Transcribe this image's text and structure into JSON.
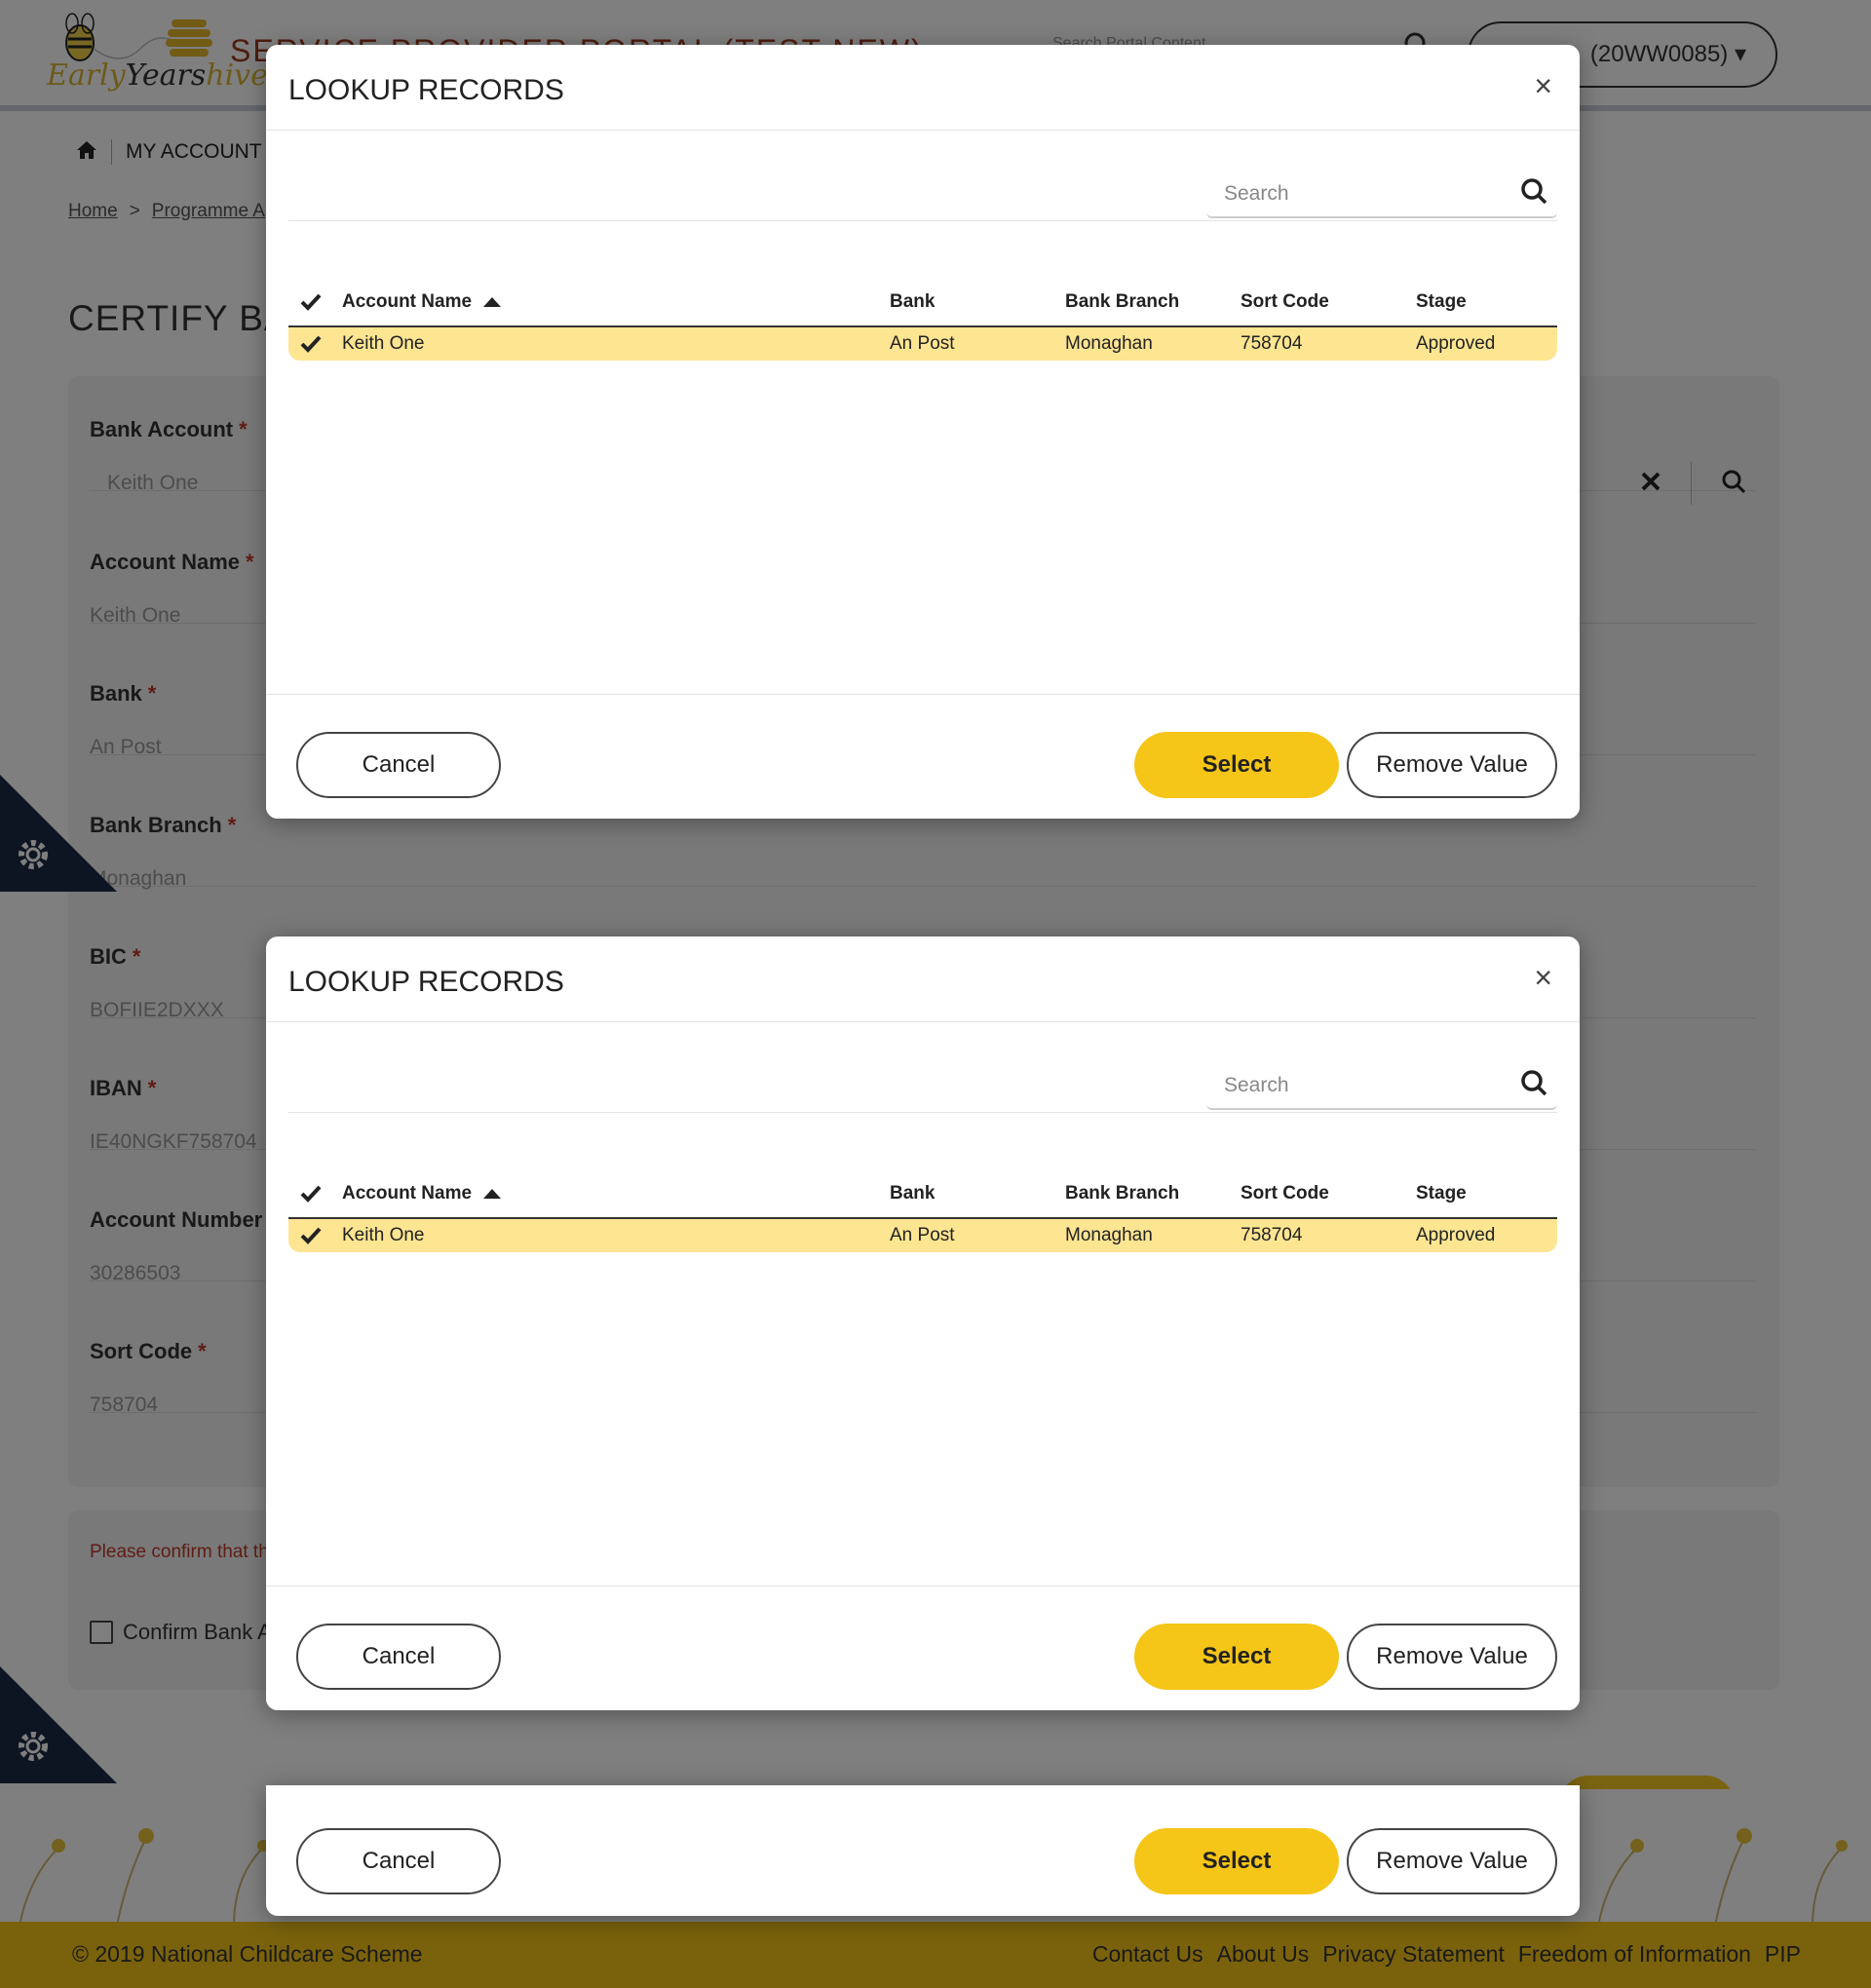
{
  "header": {
    "logo_text_dark": "Early",
    "logo_text_mid": "Years",
    "logo_text_hive": "hive",
    "portal_title": "SERVICE PROVIDER PORTAL (TEST NEW)",
    "search_placeholder": "Search Portal Content",
    "account_label": "(20WW0085)"
  },
  "nav": {
    "home_icon": "home-icon",
    "my_account": "MY ACCOUNT"
  },
  "breadcrumb": {
    "home": "Home",
    "separator": ">",
    "current": "Programme A"
  },
  "page_title": "CERTIFY BA",
  "form": {
    "fields": [
      {
        "label": "Bank Account",
        "value": "Keith One"
      },
      {
        "label": "Account Name",
        "value": "Keith One"
      },
      {
        "label": "Bank",
        "value": "An Post"
      },
      {
        "label": "Bank Branch",
        "value": "Monaghan"
      },
      {
        "label": "BIC",
        "value": "BOFIIE2DXXX"
      },
      {
        "label": "IBAN",
        "value": "IE40NGKF758704"
      },
      {
        "label": "Account Number",
        "value": "30286503"
      },
      {
        "label": "Sort Code",
        "value": "758704"
      }
    ],
    "required_marker": "*"
  },
  "confirm": {
    "message": "Please confirm that th",
    "checkbox_label": "Confirm Bank A"
  },
  "footer": {
    "copyright": "© 2019 National Childcare Scheme",
    "links": [
      "Contact Us",
      "About Us",
      "Privacy Statement",
      "Freedom of Information",
      "PIP"
    ]
  },
  "modal": {
    "title": "LOOKUP RECORDS",
    "close": "×",
    "search_placeholder": "Search",
    "columns": [
      "Account Name",
      "Bank",
      "Bank Branch",
      "Sort Code",
      "Stage"
    ],
    "rows": [
      {
        "account_name": "Keith One",
        "bank": "An Post",
        "bank_branch": "Monaghan",
        "sort_code": "758704",
        "stage": "Approved"
      }
    ],
    "cancel": "Cancel",
    "select": "Select",
    "remove": "Remove Value"
  },
  "colors": {
    "accent_yellow": "#f5c518",
    "row_highlight": "#fde592",
    "required_red": "#c0392b"
  }
}
